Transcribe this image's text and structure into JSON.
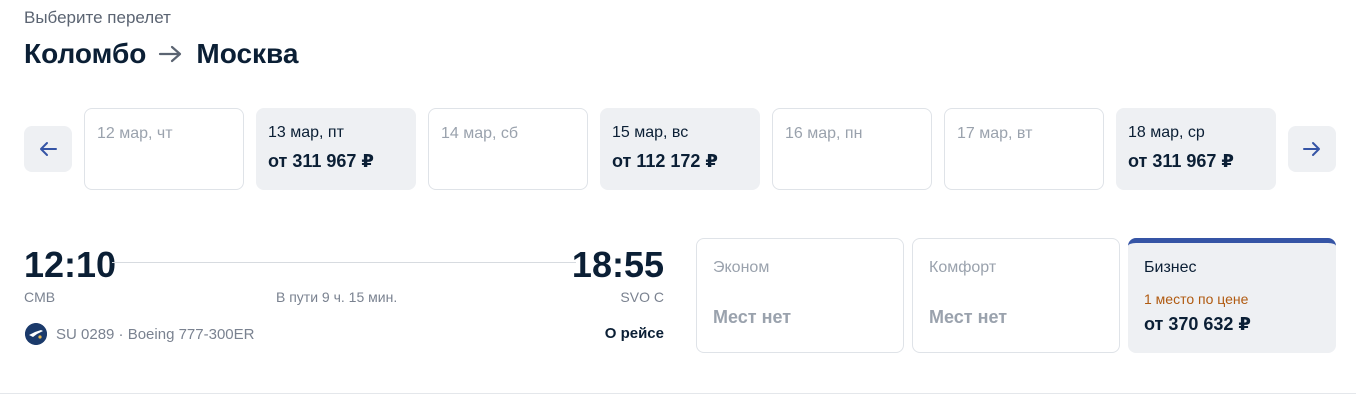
{
  "header": {
    "subtitle": "Выберите перелет",
    "origin": "Коломбо",
    "destination": "Москва"
  },
  "dates": [
    {
      "label": "12 мар, чт",
      "price": "",
      "available": false
    },
    {
      "label": "13 мар, пт",
      "price": "от 311 967 ₽",
      "available": true
    },
    {
      "label": "14 мар, сб",
      "price": "",
      "available": false
    },
    {
      "label": "15 мар, вс",
      "price": "от 112 172 ₽",
      "available": true
    },
    {
      "label": "16 мар, пн",
      "price": "",
      "available": false
    },
    {
      "label": "17 мар, вт",
      "price": "",
      "available": false
    },
    {
      "label": "18 мар, ср",
      "price": "от 311 967 ₽",
      "available": true
    }
  ],
  "flight": {
    "departure_time": "12:10",
    "arrival_time": "18:55",
    "departure_code": "CMB",
    "arrival_code": "SVO C",
    "duration": "В пути 9 ч. 15 мин.",
    "info": "SU 0289 · Boeing 777-300ER",
    "about_link": "О рейсе"
  },
  "classes": {
    "economy": {
      "name": "Эконом",
      "status": "Мест нет"
    },
    "comfort": {
      "name": "Комфорт",
      "status": "Мест нет"
    },
    "business": {
      "name": "Бизнес",
      "note": "1 место по цене",
      "price": "от 370 632 ₽"
    }
  },
  "colors": {
    "accent": "#3554a5",
    "text": "#0b1f35",
    "muted": "#7a8290",
    "card_bg": "#eef0f3",
    "note": "#b05a10"
  },
  "icons": {
    "prev": "arrow-left-icon",
    "next": "arrow-right-icon",
    "route": "arrow-right-icon",
    "airline": "airline-logo-icon"
  }
}
